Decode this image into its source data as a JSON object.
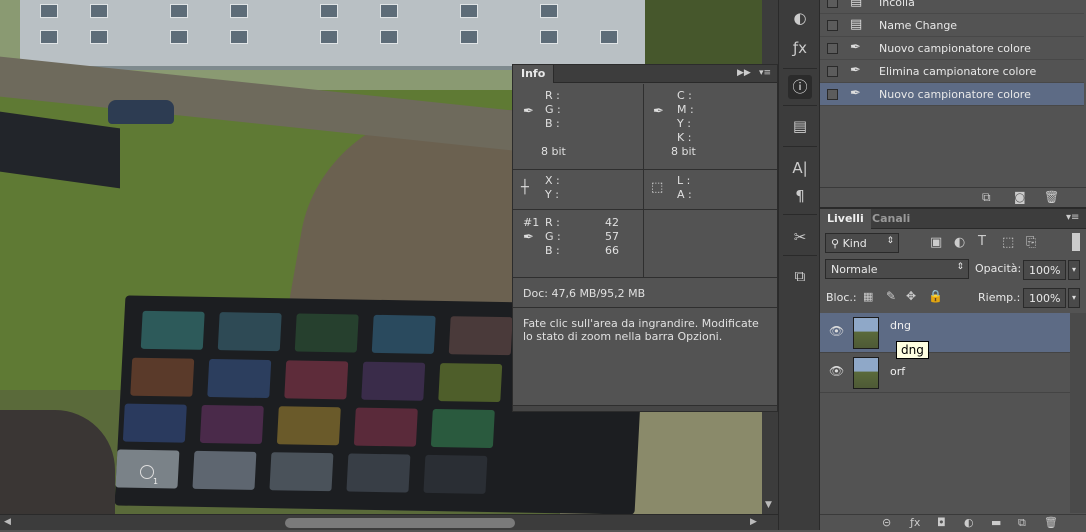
{
  "info_panel": {
    "tab": "Info",
    "rgb_labels": [
      "R :",
      "G :",
      "B :"
    ],
    "rgb_bits": "8 bit",
    "cmyk_labels": [
      "C :",
      "M :",
      "Y :",
      "K :"
    ],
    "cmyk_bits": "8 bit",
    "xy_labels": [
      "X :",
      "Y :"
    ],
    "la_labels": [
      "L :",
      "A :"
    ],
    "sampler": {
      "id": "#1",
      "labels": [
        "R :",
        "G :",
        "B :"
      ],
      "values": [
        "42",
        "57",
        "66"
      ]
    },
    "doc": "Doc: 47,6 MB/95,2 MB",
    "hint": "Fate clic sull'area da ingrandire. Modificate lo stato di zoom nella barra Opzioni."
  },
  "history": {
    "items": [
      {
        "label": "Incolla",
        "icon": "document-icon",
        "selected": false
      },
      {
        "label": "Name Change",
        "icon": "document-icon",
        "selected": false
      },
      {
        "label": "Nuovo campionatore colore",
        "icon": "eyedropper-icon",
        "selected": false
      },
      {
        "label": "Elimina campionatore colore",
        "icon": "eyedropper-icon",
        "selected": false
      },
      {
        "label": "Nuovo campionatore colore",
        "icon": "eyedropper-icon",
        "selected": true
      }
    ]
  },
  "layers_panel": {
    "tabs": [
      "Livelli",
      "Canali"
    ],
    "filter": "Kind",
    "blend_mode": "Normale",
    "opacity_label": "Opacità:",
    "opacity_value": "100%",
    "lock_label": "Bloc.:",
    "fill_label": "Riemp.:",
    "fill_value": "100%",
    "layers": [
      {
        "name": "dng",
        "selected": true
      },
      {
        "name": "orf",
        "selected": false
      }
    ],
    "tooltip": "dng"
  },
  "sampler_marker": "1",
  "colors": {
    "panel": "#535353",
    "selection": "#5d6b85",
    "dark": "#3c3c3c"
  }
}
